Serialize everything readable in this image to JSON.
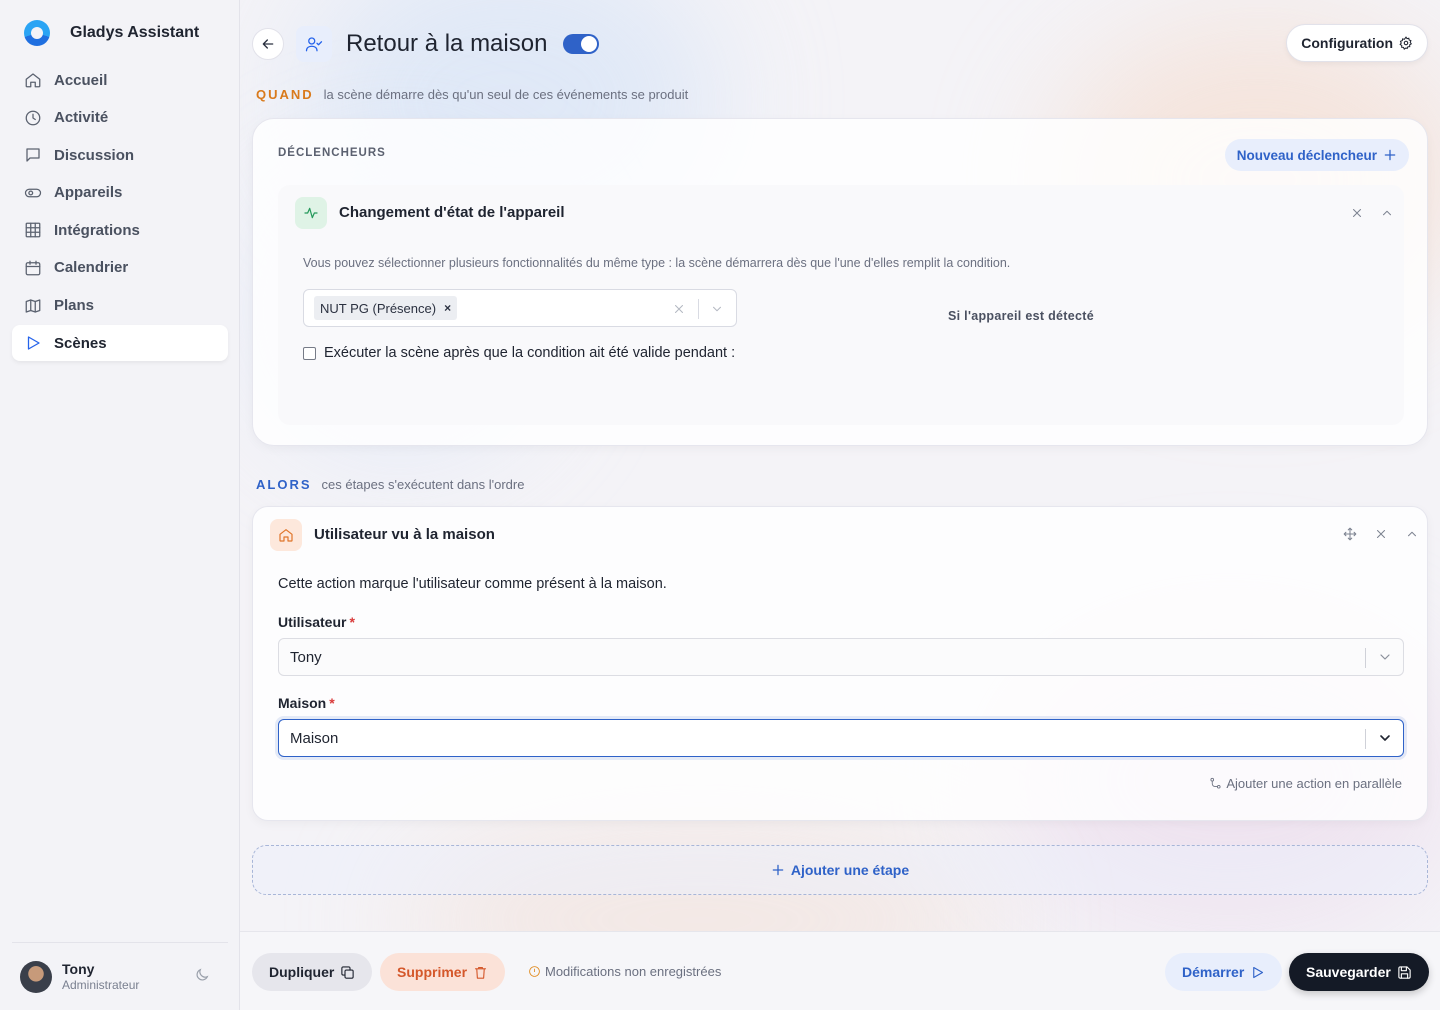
{
  "app": {
    "name": "Gladys Assistant"
  },
  "sidebar": {
    "items": [
      {
        "label": "Accueil",
        "icon": "home-icon"
      },
      {
        "label": "Activité",
        "icon": "clock-icon"
      },
      {
        "label": "Discussion",
        "icon": "message-icon"
      },
      {
        "label": "Appareils",
        "icon": "toggle-icon"
      },
      {
        "label": "Intégrations",
        "icon": "grid-icon"
      },
      {
        "label": "Calendrier",
        "icon": "calendar-icon"
      },
      {
        "label": "Plans",
        "icon": "map-icon"
      },
      {
        "label": "Scènes",
        "icon": "play-icon",
        "active": true
      }
    ],
    "user": {
      "name": "Tony",
      "role": "Administrateur"
    }
  },
  "header": {
    "title": "Retour à la maison",
    "enabled": true,
    "config_label": "Configuration"
  },
  "when": {
    "keyword": "QUAND",
    "description": "la scène démarre dès qu'un seul de ces événements se produit"
  },
  "triggers": {
    "title": "DÉCLENCHEURS",
    "new_label": "Nouveau déclencheur",
    "item": {
      "title": "Changement d'état de l'appareil",
      "help": "Vous pouvez sélectionner plusieurs fonctionnalités du même type : la scène démarrera dès que l'une d'elles remplit la condition.",
      "selected_tag": "NUT PG (Présence)",
      "condition_label": "Si l'appareil est détecté",
      "checkbox_label": "Exécuter la scène après que la condition ait été valide pendant :"
    }
  },
  "then": {
    "keyword": "ALORS",
    "description": "ces étapes s'exécutent dans l'ordre"
  },
  "action": {
    "title": "Utilisateur vu à la maison",
    "description": "Cette action marque l'utilisateur comme présent à la maison.",
    "user_label": "Utilisateur",
    "user_value": "Tony",
    "house_label": "Maison",
    "house_value": "Maison",
    "parallel_label": "Ajouter une action en parallèle"
  },
  "add_step_label": "Ajouter une étape",
  "footer": {
    "duplicate_label": "Dupliquer",
    "delete_label": "Supprimer",
    "unsaved_label": "Modifications non enregistrées",
    "start_label": "Démarrer",
    "save_label": "Sauvegarder"
  },
  "colors": {
    "accent": "#2f62c8",
    "when": "#d97a1c",
    "danger": "#d4572a",
    "dark": "#141a26"
  }
}
